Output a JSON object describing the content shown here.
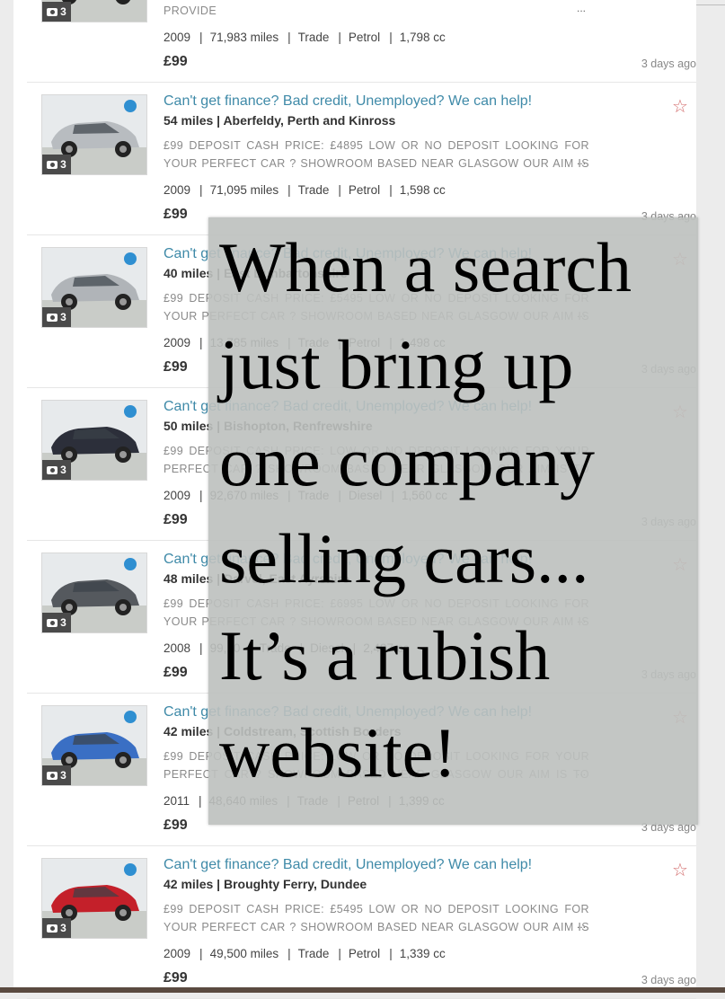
{
  "listings": [
    {
      "title": "",
      "location": "",
      "desc": "PERFECT CAR ? SHOWROOM BASED NEAR GLASGOW OUR AIM IS TO PROVIDE",
      "more": "...",
      "photos": "3",
      "year": "2009",
      "miles": "71,983 miles",
      "seller": "Trade",
      "fuel": "Petrol",
      "engine": "1,798 cc",
      "price": "£99",
      "age": "3 days ago",
      "car_color": "#9aa0a6"
    },
    {
      "title": "Can't get finance? Bad credit, Unemployed? We can help!",
      "location": "54 miles | Aberfeldy, Perth and Kinross",
      "desc": "£99 DEPOSIT CASH PRICE: £4895 LOW OR NO DEPOSIT LOOKING FOR YOUR PERFECT CAR ? SHOWROOM BASED NEAR GLASGOW OUR AIM IS TO PROVIDE",
      "more": "...",
      "photos": "3",
      "year": "2009",
      "miles": "71,095 miles",
      "seller": "Trade",
      "fuel": "Petrol",
      "engine": "1,598 cc",
      "price": "£99",
      "age": "3 days ago",
      "car_color": "#b8bcc0"
    },
    {
      "title": "Can't get finance? Bad credit, Unemployed? We can help!",
      "location": "40 miles | East Dunbartonshire",
      "desc": "£99 DEPOSIT CASH PRICE: £5495 LOW OR NO DEPOSIT LOOKING FOR YOUR PERFECT CAR ? SHOWROOM BASED NEAR GLASGOW OUR AIM IS TO PROVIDE",
      "more": "...",
      "photos": "3",
      "year": "2009",
      "miles": "13,785 miles",
      "seller": "Trade",
      "fuel": "Petrol",
      "engine": "1,498 cc",
      "price": "£99",
      "age": "3 days ago",
      "car_color": "#b0b4b8"
    },
    {
      "title": "Can't get finance? Bad credit, Unemployed? We can help!",
      "location": "50 miles | Bishopton, Renfrewshire",
      "desc": "£99 DEPOSIT CASH PRICE: LOW OR NO DEPOSIT LOOKING FOR YOUR PERFECT CAR ? SHOWROOM BASED NEAR GLASGOW OUR AIM IS TO PROVIDE",
      "more": "...",
      "photos": "3",
      "year": "2009",
      "miles": "92,670 miles",
      "seller": "Trade",
      "fuel": "Diesel",
      "engine": "1,560 cc",
      "price": "£99",
      "age": "3 days ago",
      "car_color": "#2c2f3a"
    },
    {
      "title": "Can't get finance? Bad credit, Unemployed? We can help!",
      "location": "48 miles | Darvel, East Ayrshire",
      "desc": "£99 DEPOSIT CASH PRICE: £6995 LOW OR NO DEPOSIT LOOKING FOR YOUR PERFECT CAR ? SHOWROOM BASED NEAR GLASGOW OUR AIM IS TO PROVIDE",
      "more": "...",
      "photos": "3",
      "year": "2008",
      "miles": "99,10",
      "seller": "Trade",
      "fuel": "Diesel",
      "engine": "2,497 cc",
      "price": "£99",
      "age": "3 days ago",
      "car_color": "#55595e"
    },
    {
      "title": "Can't get finance? Bad credit, Unemployed? We can help!",
      "location": "42 miles | Coldstream, Scottish Borders",
      "desc": "£99 DEPOSIT CASH PRICE: LOW OR NO DEPOSIT LOOKING FOR YOUR PERFECT CAR ? SHOWROOM BASED NEAR GLASGOW OUR AIM IS TO PROVIDE CAR FINA",
      "more": "...",
      "photos": "3",
      "year": "2011",
      "miles": "48,640 miles",
      "seller": "Trade",
      "fuel": "Petrol",
      "engine": "1,399 cc",
      "price": "£99",
      "age": "3 days ago",
      "car_color": "#3a6fc4"
    },
    {
      "title": "Can't get finance? Bad credit, Unemployed? We can help!",
      "location": "42 miles | Broughty Ferry, Dundee",
      "desc": "£99 DEPOSIT CASH PRICE: £5495 LOW OR NO DEPOSIT LOOKING FOR YOUR PERFECT CAR ? SHOWROOM BASED NEAR GLASGOW OUR AIM IS TO PROVIDE",
      "more": "...",
      "photos": "3",
      "year": "2009",
      "miles": "49,500 miles",
      "seller": "Trade",
      "fuel": "Petrol",
      "engine": "1,339 cc",
      "price": "£99",
      "age": "3 days ago",
      "car_color": "#c4202a"
    }
  ],
  "icons": {
    "star": "☆",
    "camera": "camera-icon"
  },
  "overlay": {
    "lines": [
      "When a search",
      "just bring up",
      "one company",
      "selling cars...",
      "It’s a rubish",
      "website!"
    ]
  }
}
